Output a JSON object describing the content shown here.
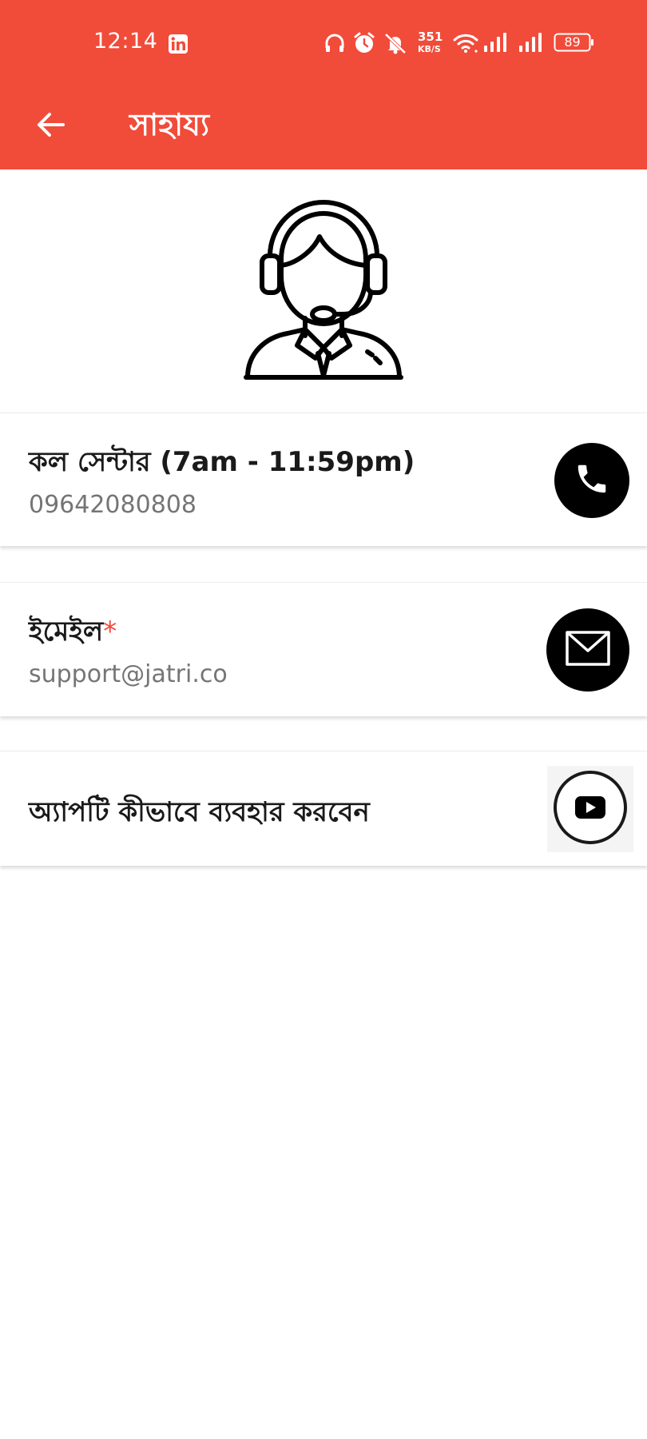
{
  "status_bar": {
    "time": "12:14",
    "network_speed_value": "351",
    "network_speed_unit": "KB/S",
    "battery_level": "89",
    "icons": [
      "linkedin-icon",
      "headphones-icon",
      "alarm-icon",
      "mute-icon",
      "wifi-icon",
      "signal-icon",
      "signal-icon",
      "battery-icon"
    ]
  },
  "app_bar": {
    "title": "সাহায্য",
    "back_icon": "arrow-left-icon"
  },
  "hero": {
    "icon": "support-agent-icon"
  },
  "contacts": [
    {
      "title": "কল সেন্টার (7am - 11:59pm)",
      "subtitle": "09642080808",
      "icon": "phone-icon"
    },
    {
      "title": "ইমেইল",
      "required_mark": "*",
      "subtitle": "support@jatri.co",
      "icon": "mail-icon"
    },
    {
      "title": "অ্যাপটি কীভাবে ব্যবহার করবেন",
      "icon": "youtube-icon"
    }
  ],
  "colors": {
    "primary": "#f14b3a",
    "text_primary": "#1a1a1a",
    "text_secondary": "#757575",
    "background": "#ffffff"
  }
}
